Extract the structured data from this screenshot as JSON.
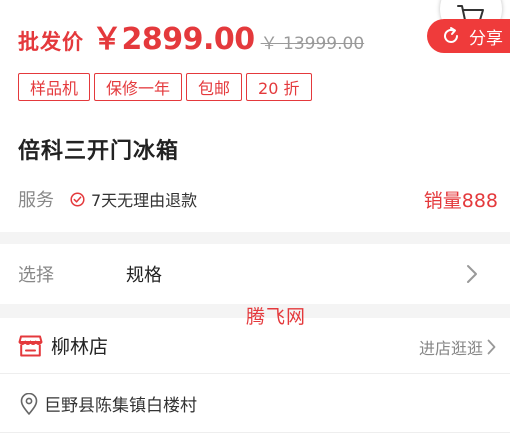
{
  "price": {
    "label": "批发价",
    "current": "￥2899.00",
    "original": "￥ 13999.00"
  },
  "share": {
    "label": "分享"
  },
  "tags": [
    "样品机",
    "保修一年",
    "包邮",
    "20 折"
  ],
  "product": {
    "title": "倍科三开门冰箱"
  },
  "service": {
    "label": "服务",
    "text": "7天无理由退款",
    "sales": "销量888"
  },
  "select": {
    "label": "选择",
    "value": "规格"
  },
  "watermark": "腾飞网",
  "store": {
    "name": "柳林店",
    "link": "进店逛逛"
  },
  "address": "巨野县陈集镇白楼村",
  "colors": {
    "accent": "#e4393c",
    "share_bg": "#ef3b3b",
    "muted": "#888888"
  }
}
